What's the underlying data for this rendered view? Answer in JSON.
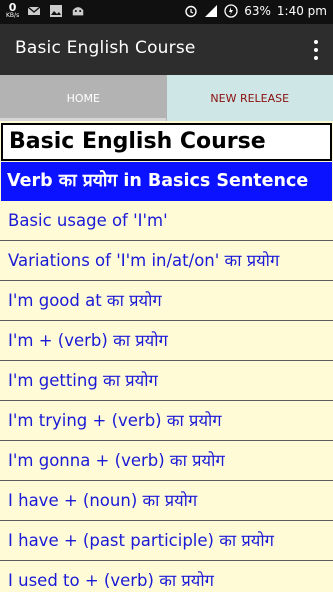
{
  "status_bar": {
    "net_speed": "0",
    "net_unit": "KB/s",
    "battery": "63%",
    "time": "1:40 pm",
    "icons": [
      "mail-icon",
      "image-icon",
      "android-icon",
      "alarm-icon",
      "signal-icon",
      "battery-icon"
    ]
  },
  "app_bar": {
    "title": "Basic English Course",
    "menu_icon": "more-vert-icon"
  },
  "tabs": [
    {
      "label": "HOME"
    },
    {
      "label": "NEW RELEASE"
    }
  ],
  "content": {
    "course_title": "Basic English Course",
    "section_title": "Verb का प्रयोग in Basics Sentence",
    "items": [
      {
        "label": "Basic usage of 'I'm'"
      },
      {
        "label": "Variations of 'I'm in/at/on' का प्रयोग"
      },
      {
        "label": "I'm good at का प्रयोग"
      },
      {
        "label": "I'm + (verb) का प्रयोग"
      },
      {
        "label": "I'm getting का प्रयोग"
      },
      {
        "label": "I'm trying + (verb) का प्रयोग"
      },
      {
        "label": "I'm gonna + (verb) का प्रयोग"
      },
      {
        "label": "I have + (noun) का प्रयोग"
      },
      {
        "label": "I have + (past participle) का प्रयोग"
      },
      {
        "label": "I used to + (verb) का प्रयोग"
      }
    ]
  },
  "colors": {
    "section_header_bg": "#0b12ff",
    "list_text": "#1a1ad6",
    "content_bg": "#fffbd6",
    "tab_new_text": "#8b0f0f"
  }
}
